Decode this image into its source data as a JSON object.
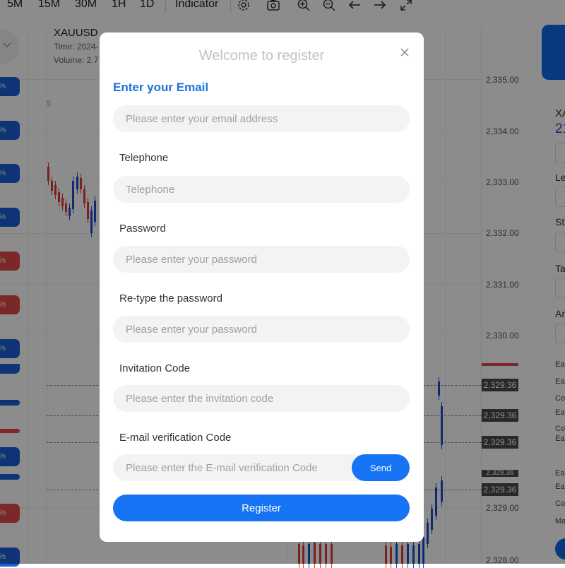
{
  "toolbar": {
    "timeframes": [
      "5M",
      "15M",
      "30M",
      "1H",
      "1D"
    ],
    "indicator_label": "Indicator"
  },
  "chart": {
    "symbol": "XAUUSD",
    "time_label": "Time: 2024-",
    "volume_label": "Volume: 2.7",
    "left_fragment": "5",
    "price_levels": [
      "2,335.00",
      "2,334.00",
      "2,333.00",
      "2,332.00",
      "2,331.00",
      "2,330.00",
      "2,329.00",
      "2,328.00"
    ],
    "price_tags": [
      "2,329.36",
      "2,329.36",
      "2,329.36",
      "2,329.36",
      "2,329.36"
    ],
    "bull_color": "#1a4fc9",
    "bear_color": "#e03b3b"
  },
  "side_badges": [
    {
      "text": "%",
      "color": "blue"
    },
    {
      "text": "%",
      "color": "blue"
    },
    {
      "text": "%",
      "color": "blue"
    },
    {
      "text": "%",
      "color": "blue"
    },
    {
      "text": "%",
      "color": "red"
    },
    {
      "text": "%",
      "color": "red"
    },
    {
      "text": "%",
      "color": "blue"
    },
    {
      "text": "%",
      "color": "blue"
    },
    {
      "text": "%",
      "color": "red"
    },
    {
      "text": "%",
      "color": "blue"
    }
  ],
  "right_panel": {
    "labels": [
      "XA",
      "21",
      "Le",
      "St",
      "Ta",
      "Ar",
      "Ea",
      "Ea",
      "Co",
      "Ea",
      "Co",
      "Ea",
      "Ea",
      "Ea",
      "Co",
      "Ma"
    ]
  },
  "modal": {
    "title": "Welcome to register",
    "email": {
      "label": "Enter your Email",
      "placeholder": "Please enter your email address",
      "value": ""
    },
    "telephone": {
      "label": "Telephone",
      "placeholder": "Telephone",
      "value": ""
    },
    "password": {
      "label": "Password",
      "placeholder": "Please enter your password",
      "value": ""
    },
    "retype": {
      "label": "Re-type the password",
      "placeholder": "Please enter your password",
      "value": ""
    },
    "invitation": {
      "label": "Invitation Code",
      "placeholder": "Please enter the invitation code",
      "value": ""
    },
    "verification": {
      "label": "E-mail verification Code",
      "placeholder": "Please enter the E-mail verification Code",
      "value": ""
    },
    "send_label": "Send",
    "register_label": "Register"
  },
  "colors": {
    "accent": "#1673f4",
    "email_label": "#1a73d9",
    "overlay": "rgba(0,0,0,0.45)"
  }
}
